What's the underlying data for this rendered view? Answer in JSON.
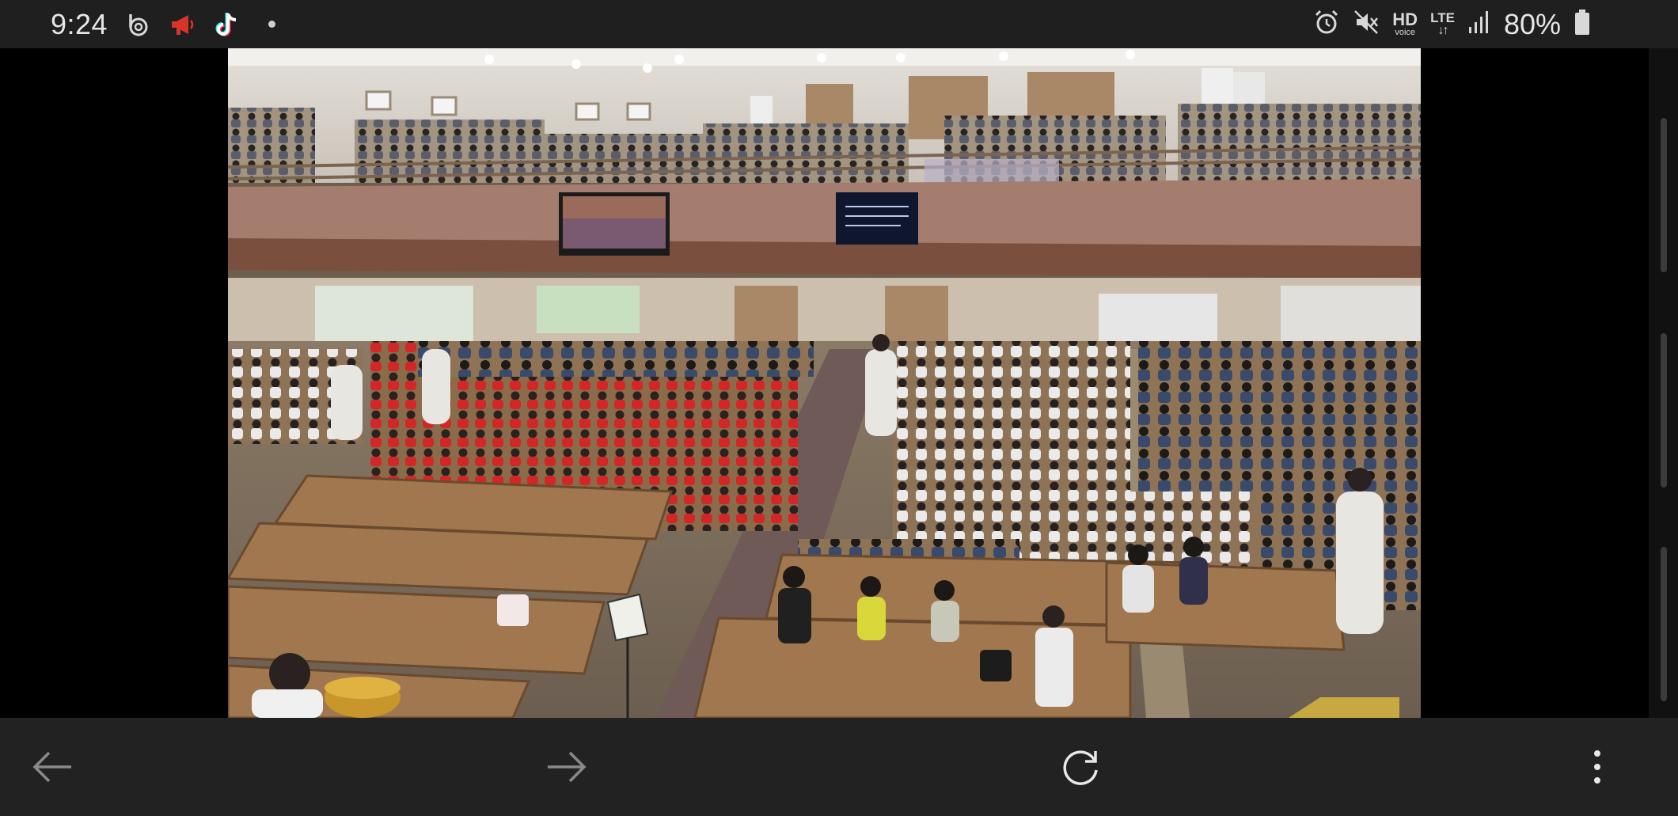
{
  "status_bar": {
    "time": "9:24",
    "notification_icons": [
      "b-app-icon",
      "megaphone-icon",
      "tiktok-icon",
      "more-dot-icon"
    ],
    "system_icons": [
      "alarm-icon",
      "mute-icon",
      "hd-voice-icon",
      "lte-icon",
      "signal-icon",
      "battery-icon"
    ],
    "hd_label": "HD",
    "hd_sub": "voice",
    "lte_label": "LTE",
    "battery_percent": "80%"
  },
  "video": {
    "description_icon": "church-livestream-frame"
  },
  "nav": {
    "back_icon": "arrow-left-icon",
    "forward_icon": "arrow-right-icon",
    "reload_icon": "reload-icon",
    "menu_icon": "more-vert-icon"
  },
  "colors": {
    "status_bg": "#1f1f1f",
    "nav_bg": "#222222",
    "accent_red": "#d8352a"
  }
}
